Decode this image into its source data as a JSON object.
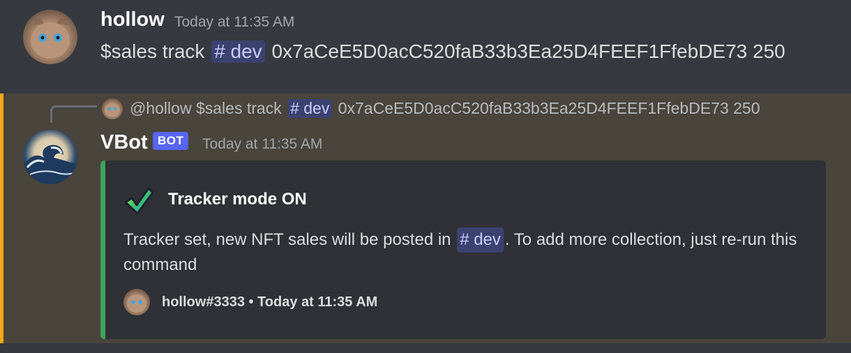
{
  "message1": {
    "author": "hollow",
    "timestamp": "Today at 11:35 AM",
    "text_before": "$sales track",
    "channel_mention": "# dev",
    "text_after": "0x7aCeE5D0acC520faB33b3Ea25D4FEEF1FfebDE73 250"
  },
  "message2": {
    "reply": {
      "mention": "@hollow",
      "text_before": "$sales track",
      "channel_mention": "# dev",
      "text_after": "0x7aCeE5D0acC520faB33b3Ea25D4FEEF1FfebDE73 250"
    },
    "author": "VBot",
    "badge": "BOT",
    "timestamp": "Today at 11:35 AM",
    "embed": {
      "icon": "check-mark-icon",
      "title": "Tracker mode ON",
      "desc_before": "Tracker set, new NFT sales will be posted in",
      "channel_mention": "# dev",
      "desc_after": ". To add more collection, just re-run this command",
      "footer": "hollow#3333 • Today at 11:35 AM",
      "accent_color": "#3ba55c"
    },
    "highlight_color": "#faa81a"
  }
}
